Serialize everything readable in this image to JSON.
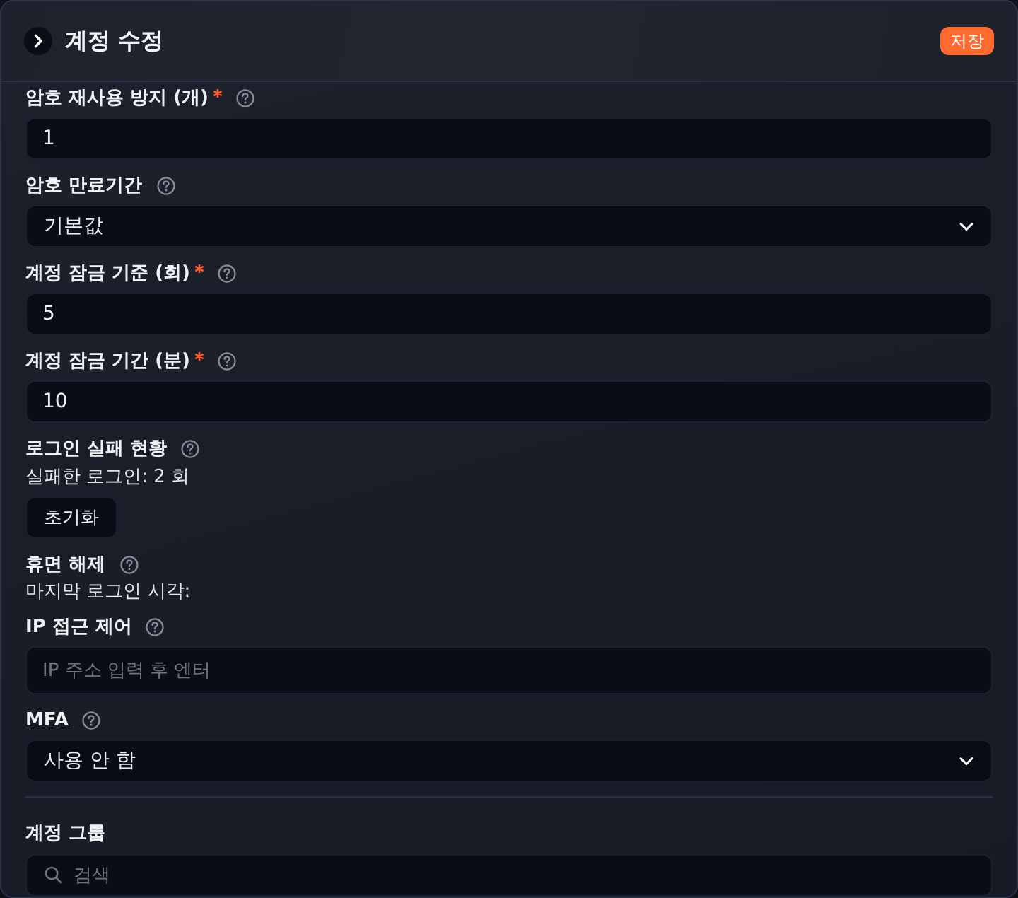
{
  "header": {
    "title": "계정 수정",
    "save_button": "저장"
  },
  "fields": [
    {
      "kind": "input",
      "label": "암호 재사용 방지 (개)",
      "required": true,
      "value": "1"
    },
    {
      "kind": "select",
      "label": "암호 만료기간",
      "required": false,
      "value": "기본값"
    },
    {
      "kind": "input",
      "label": "계정 잠금 기준 (회)",
      "required": true,
      "value": "5"
    },
    {
      "kind": "input",
      "label": "계정 잠금 기간 (분)",
      "required": true,
      "value": "10"
    },
    {
      "kind": "status",
      "label": "로그인 실패 현황",
      "required": false,
      "text": "실패한 로그인: 2 회",
      "button": "초기화"
    },
    {
      "kind": "info",
      "label": "휴면 해제",
      "required": false,
      "text": "마지막 로그인 시각:"
    },
    {
      "kind": "input",
      "label": "IP 접근 제어",
      "required": false,
      "placeholder": "IP 주소 입력 후 엔터"
    },
    {
      "kind": "select",
      "label": "MFA",
      "required": false,
      "value": "사용 안 함"
    }
  ],
  "group": {
    "label": "계정 그룹",
    "search": {
      "placeholder": "검색"
    }
  }
}
